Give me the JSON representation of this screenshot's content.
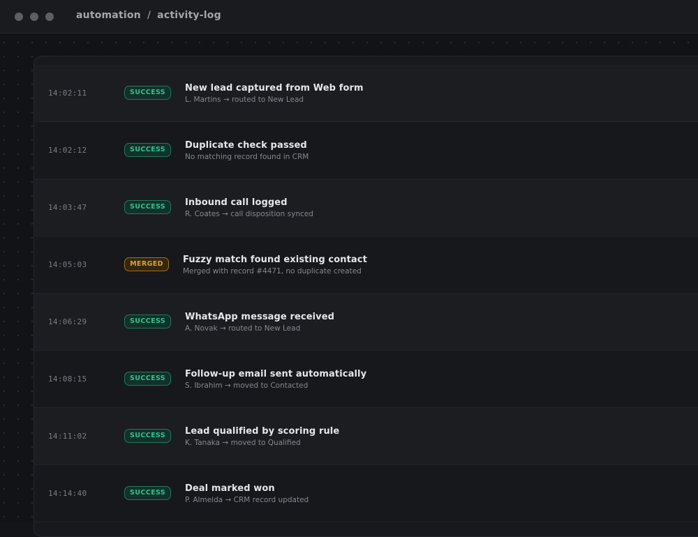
{
  "window": {
    "breadcrumb": [
      "automation",
      "activity-log"
    ],
    "separator": "/"
  },
  "colors": {
    "success": "#2ec48e",
    "merged": "#e0a030",
    "background": "#141519"
  },
  "log": {
    "rows": [
      {
        "time": "14:02:11",
        "status": "SUCCESS",
        "title": "New lead captured from Web form",
        "detail": "L. Martins → routed to New Lead"
      },
      {
        "time": "14:02:12",
        "status": "SUCCESS",
        "title": "Duplicate check passed",
        "detail": "No matching record found in CRM"
      },
      {
        "time": "14:03:47",
        "status": "SUCCESS",
        "title": "Inbound call logged",
        "detail": "R. Coates → call disposition synced"
      },
      {
        "time": "14:05:03",
        "status": "MERGED",
        "title": "Fuzzy match found existing contact",
        "detail": "Merged with record #4471, no duplicate created"
      },
      {
        "time": "14:06:29",
        "status": "SUCCESS",
        "title": "WhatsApp message received",
        "detail": "A. Novak → routed to New Lead"
      },
      {
        "time": "14:08:15",
        "status": "SUCCESS",
        "title": "Follow-up email sent automatically",
        "detail": "S. Ibrahim → moved to Contacted"
      },
      {
        "time": "14:11:02",
        "status": "SUCCESS",
        "title": "Lead qualified by scoring rule",
        "detail": "K. Tanaka → moved to Qualified"
      },
      {
        "time": "14:14:40",
        "status": "SUCCESS",
        "title": "Deal marked won",
        "detail": "P. Almeida → CRM record updated"
      }
    ]
  }
}
